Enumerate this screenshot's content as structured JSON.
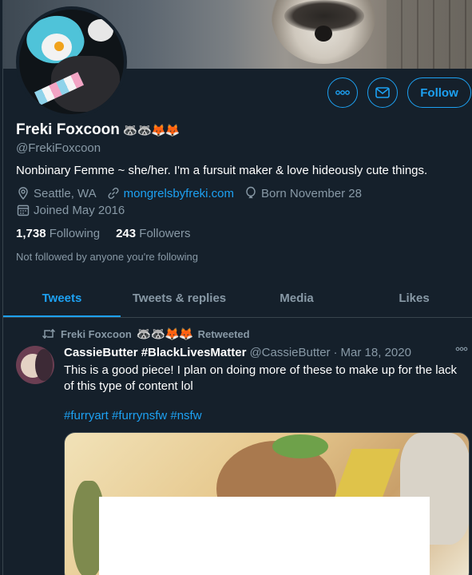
{
  "profile": {
    "display_name": "Freki Foxcoon",
    "name_emoji": "🦝🦝🦊🦊",
    "handle": "@FrekiFoxcoon",
    "bio": "Nonbinary Femme ~ she/her. I'm a fursuit maker & love hideously cute things.",
    "location": "Seattle, WA",
    "website": "mongrelsbyfreki.com",
    "birthday": "Born November 28",
    "joined": "Joined May 2016",
    "following_count": "1,738",
    "following_label": "Following",
    "followers_count": "243",
    "followers_label": "Followers",
    "not_followed": "Not followed by anyone you're following"
  },
  "actions": {
    "more_icon": "more-horizontal-icon",
    "message_icon": "envelope-icon",
    "follow_label": "Follow"
  },
  "tabs": [
    {
      "label": "Tweets",
      "active": true
    },
    {
      "label": "Tweets & replies",
      "active": false
    },
    {
      "label": "Media",
      "active": false
    },
    {
      "label": "Likes",
      "active": false
    }
  ],
  "tweet": {
    "retweeter": "Freki Foxcoon",
    "retweeter_emoji": "🦝🦝🦊🦊",
    "retweet_suffix": "Retweeted",
    "author": "CassieButter #BlackLivesMatter",
    "author_handle": "@CassieButter",
    "separator": "·",
    "date": "Mar 18, 2020",
    "text": "This is a good piece! I plan on doing more of these to make up for the lack of this type of content lol",
    "hashtags": "#furryart #furrynsfw #nsfw"
  },
  "colors": {
    "background": "#15202b",
    "accent": "#1da1f2",
    "secondary_text": "#8899a6",
    "border": "#38444d"
  }
}
